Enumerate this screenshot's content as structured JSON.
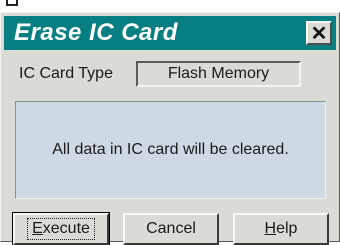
{
  "window": {
    "title": "Erase IC Card",
    "close_glyph": "✕"
  },
  "card_type": {
    "label": "IC Card Type",
    "value": "Flash Memory"
  },
  "message": "All data in IC card will be cleared.",
  "buttons": {
    "execute": {
      "mnemonic": "E",
      "rest": "xecute"
    },
    "cancel": "Cancel",
    "help": {
      "mnemonic": "H",
      "rest": "elp"
    }
  },
  "colors": {
    "titlebar": "#077f82",
    "dialog_bg": "#dbdbd6",
    "message_bg": "#cfd9e3"
  }
}
